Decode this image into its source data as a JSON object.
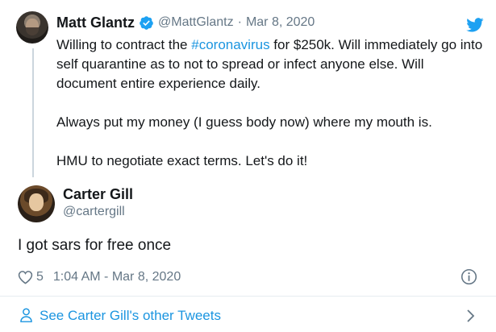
{
  "parent_tweet": {
    "name": "Matt Glantz",
    "handle": "@MattGlantz",
    "separator": "·",
    "date": "Mar 8, 2020",
    "line1_before": "Willing to contract the ",
    "hashtag": "#coronavirus",
    "line1_after": " for $250k.  Will immediately go into self quarantine as to not to spread or infect anyone else. Will document entire experience daily.",
    "paragraph2": "Always put my money (I guess body now) where my mouth is.",
    "paragraph3": "HMU to negotiate exact terms. Let's do it!"
  },
  "reply": {
    "name": "Carter Gill",
    "handle": "@cartergill",
    "text": "I got sars for free once",
    "like_count": "5",
    "timestamp": "1:04 AM - Mar 8, 2020"
  },
  "footer": {
    "link_text": "See Carter Gill's other Tweets"
  },
  "colors": {
    "link": "#1b95e0",
    "secondary_text": "#657786",
    "twitter_blue": "#1da1f2"
  },
  "icons": [
    "verified-icon",
    "twitter-bird-icon",
    "heart-icon",
    "info-icon",
    "person-icon",
    "chevron-right-icon"
  ]
}
